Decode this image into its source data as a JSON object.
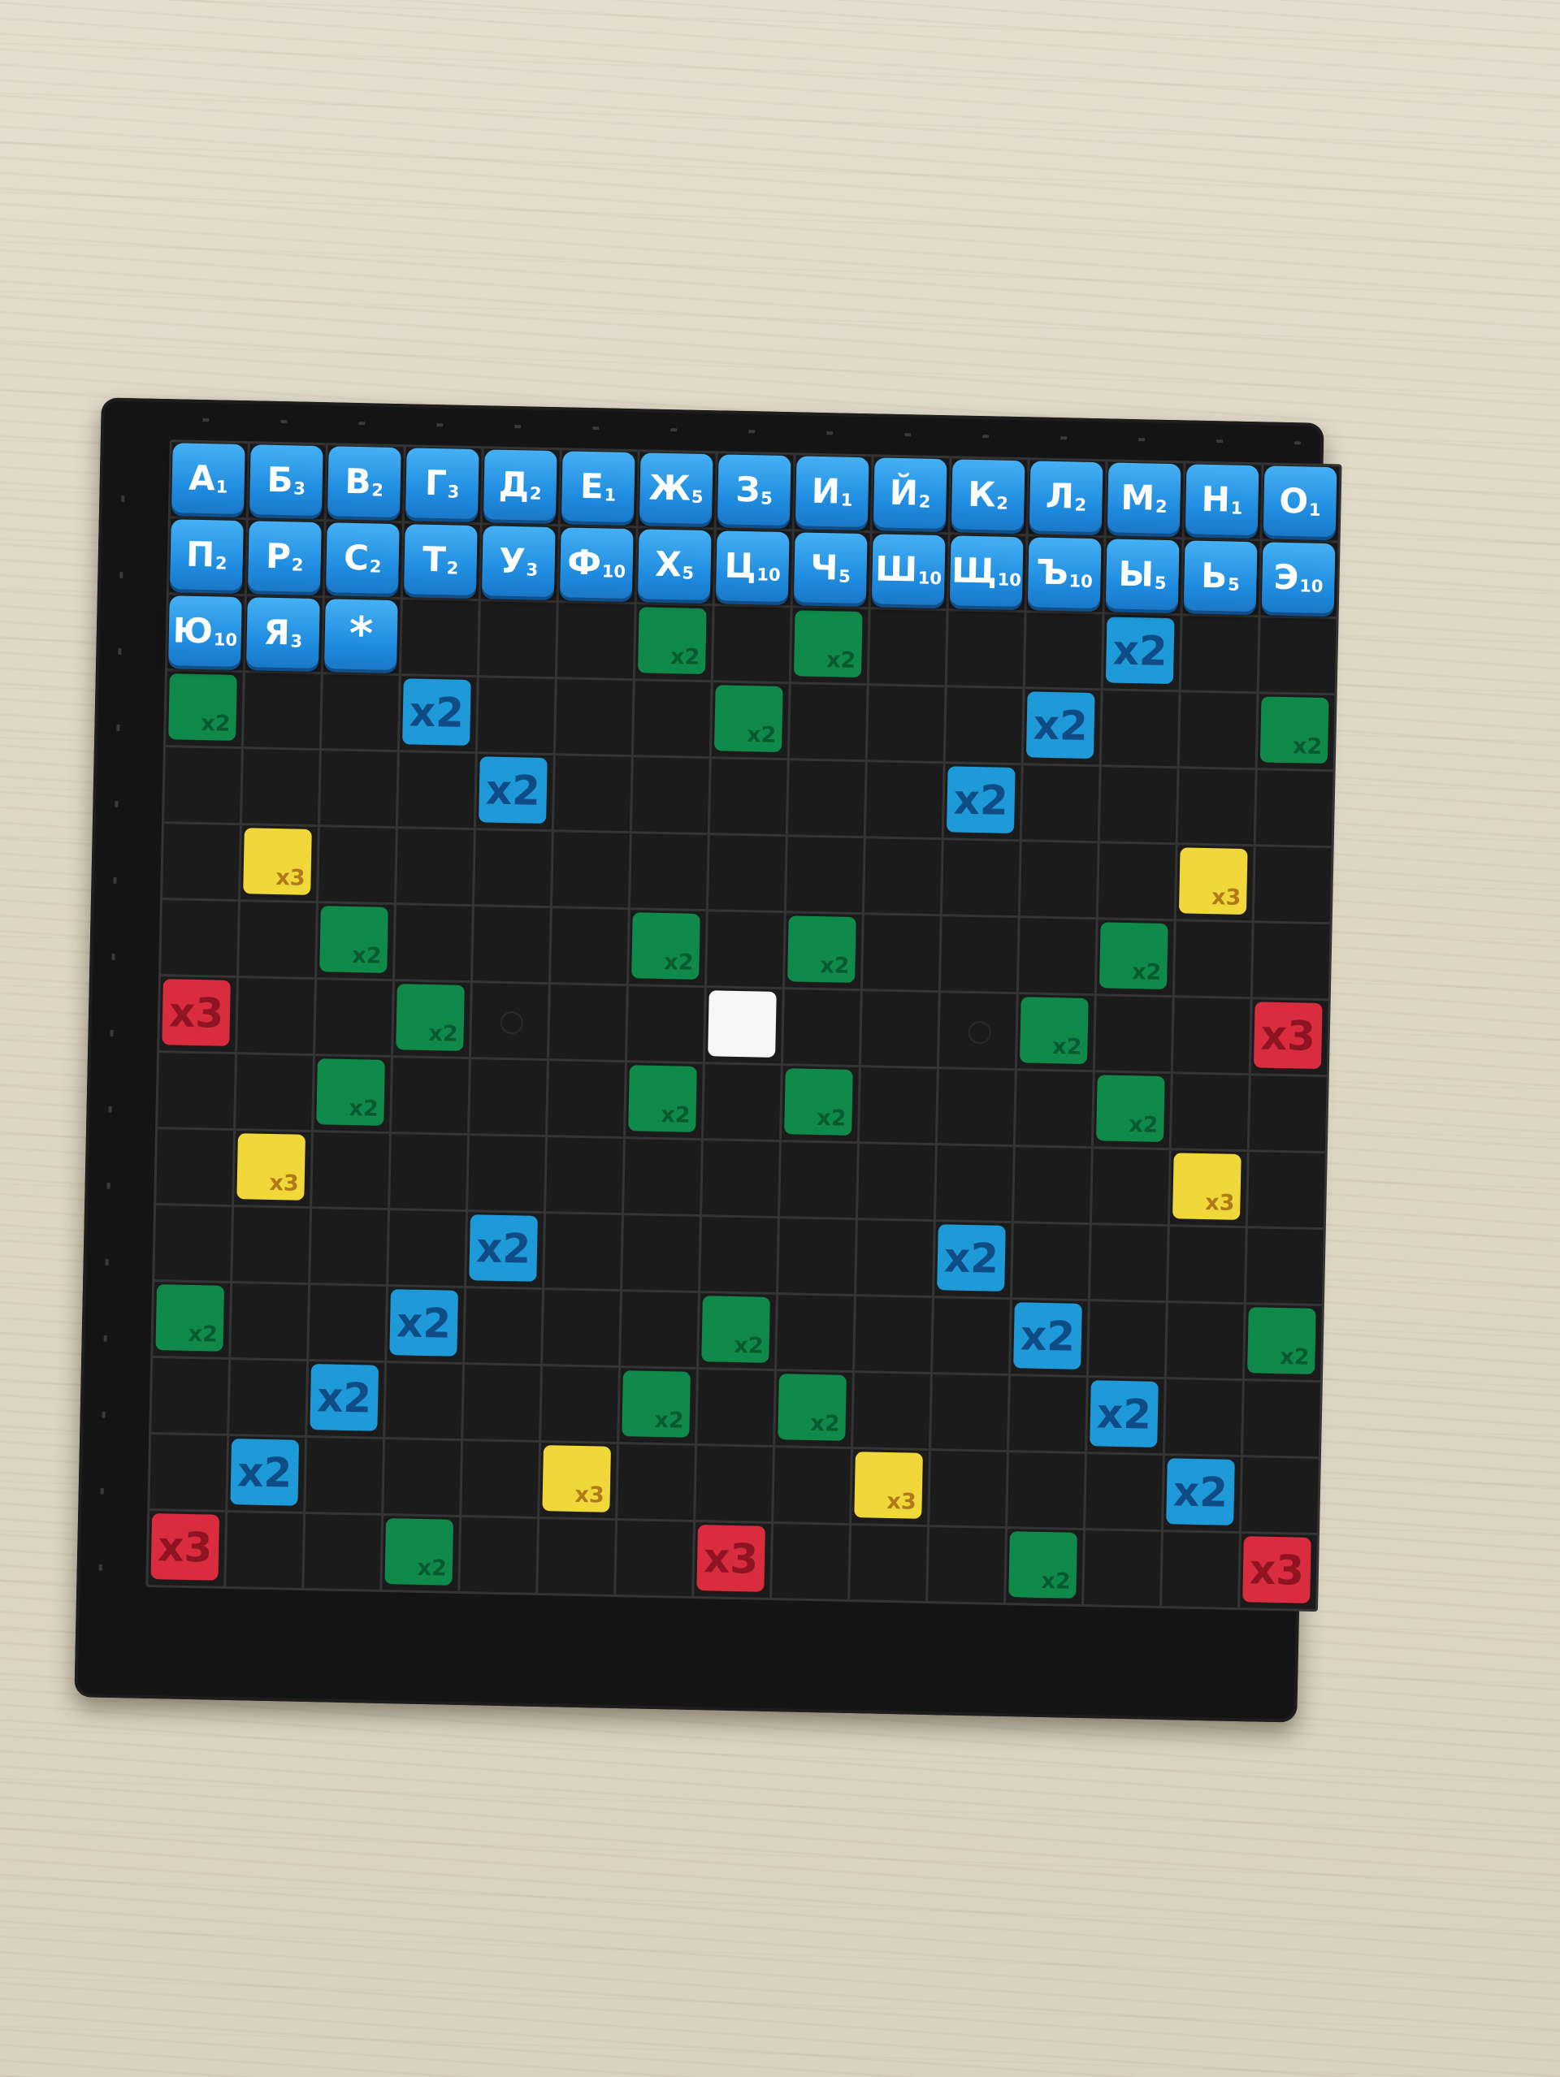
{
  "scene": {
    "background": "light wooden table",
    "board_color": "#141414"
  },
  "colors": {
    "tile": "#1f8ce0",
    "letter2": "#1e9ad8",
    "word2": "#0f8a4b",
    "letter3": "#f1d83a",
    "word3": "#d92c3f",
    "center": "#f7f7f7"
  },
  "tiles": [
    {
      "row": 0,
      "col": 0,
      "letter": "А",
      "points": "1"
    },
    {
      "row": 0,
      "col": 1,
      "letter": "Б",
      "points": "3"
    },
    {
      "row": 0,
      "col": 2,
      "letter": "В",
      "points": "2"
    },
    {
      "row": 0,
      "col": 3,
      "letter": "Г",
      "points": "3"
    },
    {
      "row": 0,
      "col": 4,
      "letter": "Д",
      "points": "2"
    },
    {
      "row": 0,
      "col": 5,
      "letter": "Е",
      "points": "1"
    },
    {
      "row": 0,
      "col": 6,
      "letter": "Ж",
      "points": "5"
    },
    {
      "row": 0,
      "col": 7,
      "letter": "З",
      "points": "5"
    },
    {
      "row": 0,
      "col": 8,
      "letter": "И",
      "points": "1"
    },
    {
      "row": 0,
      "col": 9,
      "letter": "Й",
      "points": "2"
    },
    {
      "row": 0,
      "col": 10,
      "letter": "К",
      "points": "2"
    },
    {
      "row": 0,
      "col": 11,
      "letter": "Л",
      "points": "2"
    },
    {
      "row": 0,
      "col": 12,
      "letter": "М",
      "points": "2"
    },
    {
      "row": 0,
      "col": 13,
      "letter": "Н",
      "points": "1"
    },
    {
      "row": 0,
      "col": 14,
      "letter": "О",
      "points": "1"
    },
    {
      "row": 1,
      "col": 0,
      "letter": "П",
      "points": "2"
    },
    {
      "row": 1,
      "col": 1,
      "letter": "Р",
      "points": "2"
    },
    {
      "row": 1,
      "col": 2,
      "letter": "С",
      "points": "2"
    },
    {
      "row": 1,
      "col": 3,
      "letter": "Т",
      "points": "2"
    },
    {
      "row": 1,
      "col": 4,
      "letter": "У",
      "points": "3"
    },
    {
      "row": 1,
      "col": 5,
      "letter": "Ф",
      "points": "10"
    },
    {
      "row": 1,
      "col": 6,
      "letter": "Х",
      "points": "5"
    },
    {
      "row": 1,
      "col": 7,
      "letter": "Ц",
      "points": "10"
    },
    {
      "row": 1,
      "col": 8,
      "letter": "Ч",
      "points": "5"
    },
    {
      "row": 1,
      "col": 9,
      "letter": "Ш",
      "points": "10"
    },
    {
      "row": 1,
      "col": 10,
      "letter": "Щ",
      "points": "10"
    },
    {
      "row": 1,
      "col": 11,
      "letter": "Ъ",
      "points": "10"
    },
    {
      "row": 1,
      "col": 12,
      "letter": "Ы",
      "points": "5"
    },
    {
      "row": 1,
      "col": 13,
      "letter": "Ь",
      "points": "5"
    },
    {
      "row": 1,
      "col": 14,
      "letter": "Э",
      "points": "10"
    },
    {
      "row": 2,
      "col": 0,
      "letter": "Ю",
      "points": "10"
    },
    {
      "row": 2,
      "col": 1,
      "letter": "Я",
      "points": "3"
    },
    {
      "row": 2,
      "col": 2,
      "letter": "*",
      "points": ""
    }
  ],
  "premium_squares": [
    {
      "row": 2,
      "col": 6,
      "type": "word2",
      "label": "x2"
    },
    {
      "row": 2,
      "col": 8,
      "type": "word2",
      "label": "x2"
    },
    {
      "row": 2,
      "col": 12,
      "type": "letter2",
      "label": "x2"
    },
    {
      "row": 3,
      "col": 0,
      "type": "word2",
      "label": "x2"
    },
    {
      "row": 3,
      "col": 3,
      "type": "letter2",
      "label": "x2"
    },
    {
      "row": 3,
      "col": 7,
      "type": "word2",
      "label": "x2"
    },
    {
      "row": 3,
      "col": 11,
      "type": "letter2",
      "label": "x2"
    },
    {
      "row": 3,
      "col": 14,
      "type": "word2",
      "label": "x2"
    },
    {
      "row": 4,
      "col": 4,
      "type": "letter2",
      "label": "x2"
    },
    {
      "row": 4,
      "col": 10,
      "type": "letter2",
      "label": "x2"
    },
    {
      "row": 5,
      "col": 1,
      "type": "letter3",
      "label": "x3"
    },
    {
      "row": 5,
      "col": 13,
      "type": "letter3",
      "label": "x3"
    },
    {
      "row": 6,
      "col": 2,
      "type": "word2",
      "label": "x2"
    },
    {
      "row": 6,
      "col": 6,
      "type": "word2",
      "label": "x2"
    },
    {
      "row": 6,
      "col": 8,
      "type": "word2",
      "label": "x2"
    },
    {
      "row": 6,
      "col": 12,
      "type": "word2",
      "label": "x2"
    },
    {
      "row": 7,
      "col": 0,
      "type": "word3",
      "label": "x3"
    },
    {
      "row": 7,
      "col": 3,
      "type": "word2",
      "label": "x2"
    },
    {
      "row": 7,
      "col": 7,
      "type": "center",
      "label": ""
    },
    {
      "row": 7,
      "col": 11,
      "type": "word2",
      "label": "x2"
    },
    {
      "row": 7,
      "col": 14,
      "type": "word3",
      "label": "x3"
    },
    {
      "row": 8,
      "col": 2,
      "type": "word2",
      "label": "x2"
    },
    {
      "row": 8,
      "col": 6,
      "type": "word2",
      "label": "x2"
    },
    {
      "row": 8,
      "col": 8,
      "type": "word2",
      "label": "x2"
    },
    {
      "row": 8,
      "col": 12,
      "type": "word2",
      "label": "x2"
    },
    {
      "row": 9,
      "col": 1,
      "type": "letter3",
      "label": "x3"
    },
    {
      "row": 9,
      "col": 13,
      "type": "letter3",
      "label": "x3"
    },
    {
      "row": 10,
      "col": 4,
      "type": "letter2",
      "label": "x2"
    },
    {
      "row": 10,
      "col": 10,
      "type": "letter2",
      "label": "x2"
    },
    {
      "row": 11,
      "col": 0,
      "type": "word2",
      "label": "x2"
    },
    {
      "row": 11,
      "col": 3,
      "type": "letter2",
      "label": "x2"
    },
    {
      "row": 11,
      "col": 7,
      "type": "word2",
      "label": "x2"
    },
    {
      "row": 11,
      "col": 11,
      "type": "letter2",
      "label": "x2"
    },
    {
      "row": 11,
      "col": 14,
      "type": "word2",
      "label": "x2"
    },
    {
      "row": 12,
      "col": 2,
      "type": "letter2",
      "label": "x2"
    },
    {
      "row": 12,
      "col": 6,
      "type": "word2",
      "label": "x2"
    },
    {
      "row": 12,
      "col": 8,
      "type": "word2",
      "label": "x2"
    },
    {
      "row": 12,
      "col": 12,
      "type": "letter2",
      "label": "x2"
    },
    {
      "row": 13,
      "col": 1,
      "type": "letter2",
      "label": "x2"
    },
    {
      "row": 13,
      "col": 5,
      "type": "letter3",
      "label": "x3"
    },
    {
      "row": 13,
      "col": 9,
      "type": "letter3",
      "label": "x3"
    },
    {
      "row": 13,
      "col": 13,
      "type": "letter2",
      "label": "x2"
    },
    {
      "row": 14,
      "col": 0,
      "type": "word3",
      "label": "x3"
    },
    {
      "row": 14,
      "col": 3,
      "type": "word2",
      "label": "x2"
    },
    {
      "row": 14,
      "col": 7,
      "type": "word3",
      "label": "x3"
    },
    {
      "row": 14,
      "col": 11,
      "type": "word2",
      "label": "x2"
    },
    {
      "row": 14,
      "col": 14,
      "type": "word3",
      "label": "x3"
    }
  ],
  "dots": [
    {
      "row": 7,
      "col": 4
    },
    {
      "row": 7,
      "col": 10
    }
  ]
}
